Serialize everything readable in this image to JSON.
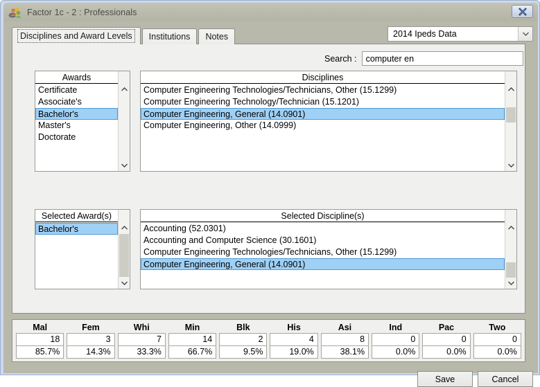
{
  "window": {
    "title": "Factor 1c - 2 : Professionals",
    "app_icon": "people-icon",
    "close_label": "✕"
  },
  "tabs": [
    {
      "label": "Disciplines and Award Levels",
      "active": true
    },
    {
      "label": "Institutions",
      "active": false
    },
    {
      "label": "Notes",
      "active": false
    }
  ],
  "dataset_select": {
    "value": "2014 Ipeds Data",
    "arrow_icon": "chevron-down-icon"
  },
  "search": {
    "label": "Search :",
    "value": "computer en",
    "placeholder": ""
  },
  "awards_list": {
    "header": "Awards",
    "items": [
      {
        "label": "Certificate",
        "selected": false
      },
      {
        "label": "Associate's",
        "selected": false
      },
      {
        "label": "Bachelor's",
        "selected": true
      },
      {
        "label": "Master's",
        "selected": false
      },
      {
        "label": "Doctorate",
        "selected": false
      }
    ]
  },
  "disciplines_list": {
    "header": "Disciplines",
    "items": [
      {
        "label": "Computer Engineering Technologies/Technicians, Other (15.1299)",
        "selected": false
      },
      {
        "label": "Computer Engineering Technology/Technician (15.1201)",
        "selected": false
      },
      {
        "label": "Computer Engineering, General (14.0901)",
        "selected": true
      },
      {
        "label": "Computer Engineering, Other (14.0999)",
        "selected": false
      }
    ]
  },
  "selected_awards_list": {
    "header": "Selected Award(s)",
    "items": [
      {
        "label": "Bachelor's",
        "selected": true
      }
    ]
  },
  "selected_disciplines_list": {
    "header": "Selected Discipline(s)",
    "items": [
      {
        "label": "Accounting (52.0301)",
        "selected": false
      },
      {
        "label": "Accounting and Computer Science (30.1601)",
        "selected": false
      },
      {
        "label": "Computer Engineering Technologies/Technicians, Other (15.1299)",
        "selected": false
      },
      {
        "label": "Computer Engineering, General (14.0901)",
        "selected": true
      }
    ]
  },
  "stats": {
    "columns": [
      {
        "header": "Mal",
        "count": "18",
        "percent": "85.7%"
      },
      {
        "header": "Fem",
        "count": "3",
        "percent": "14.3%"
      },
      {
        "header": "Whi",
        "count": "7",
        "percent": "33.3%"
      },
      {
        "header": "Min",
        "count": "14",
        "percent": "66.7%"
      },
      {
        "header": "Blk",
        "count": "2",
        "percent": "9.5%"
      },
      {
        "header": "His",
        "count": "4",
        "percent": "19.0%"
      },
      {
        "header": "Asi",
        "count": "8",
        "percent": "38.1%"
      },
      {
        "header": "Ind",
        "count": "0",
        "percent": "0.0%"
      },
      {
        "header": "Pac",
        "count": "0",
        "percent": "0.0%"
      },
      {
        "header": "Two",
        "count": "0",
        "percent": "0.0%"
      }
    ]
  },
  "footer": {
    "save_label": "Save",
    "cancel_label": "Cancel"
  },
  "colors": {
    "selection": "#9fd0f5",
    "selection_border": "#4e9ad8",
    "window_chrome": "#b8b8ab",
    "panel": "#f0f0ee"
  }
}
